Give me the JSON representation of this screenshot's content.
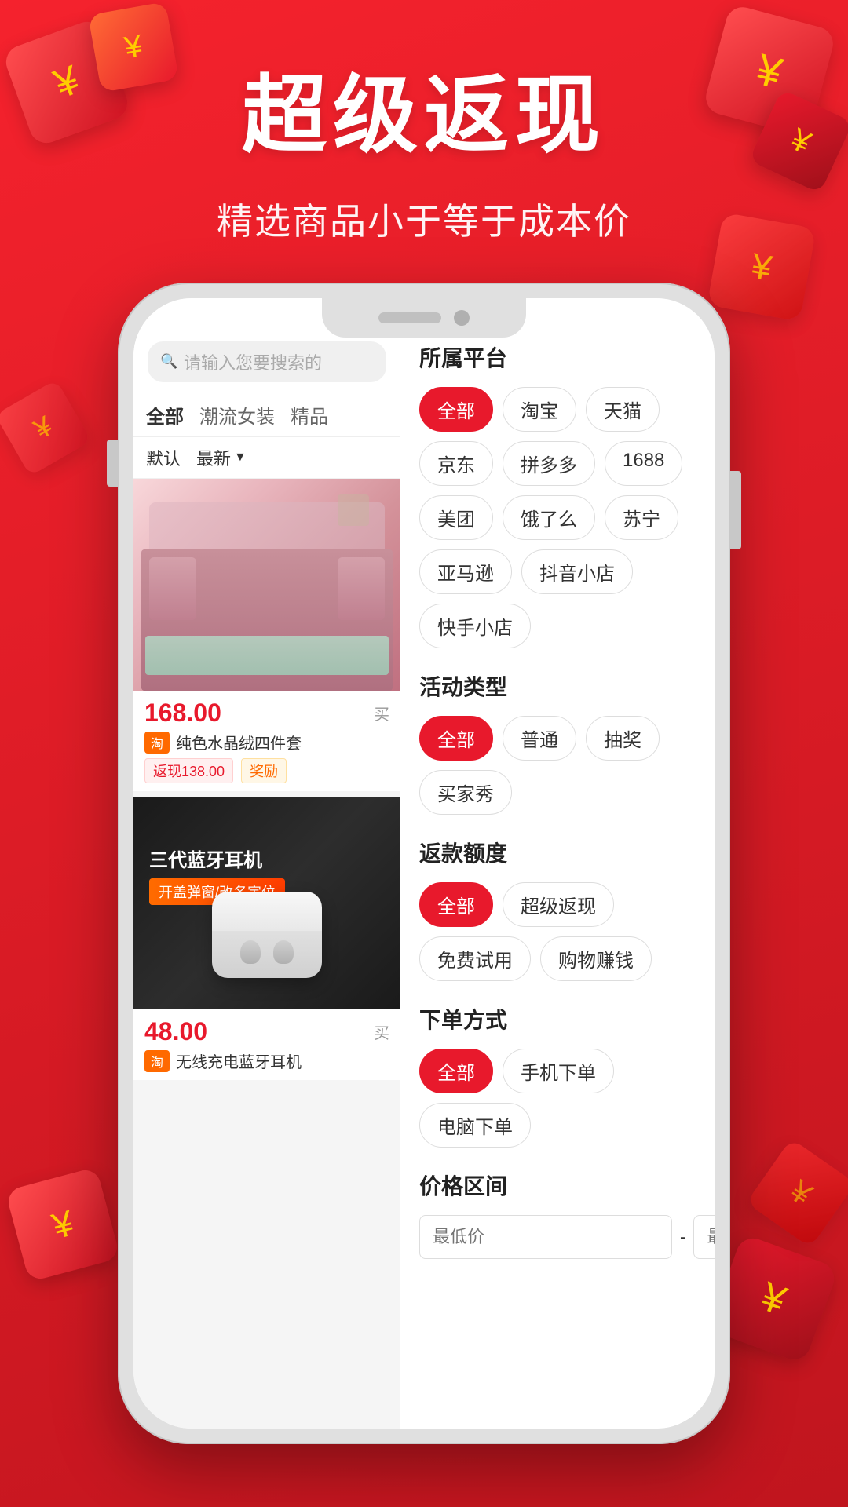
{
  "header": {
    "title": "超级返现",
    "subtitle": "精选商品小于等于成本价"
  },
  "phone": {
    "search_placeholder": "请输入您要搜索的"
  },
  "categories": {
    "tabs": [
      "全部",
      "潮流女装",
      "精品"
    ],
    "sort_options": [
      "默认",
      "最新"
    ]
  },
  "products": [
    {
      "id": 1,
      "type": "bed",
      "price": "168.00",
      "platform": "淘",
      "platform_color": "#ff6900",
      "name": "纯色水晶绒四件套",
      "cashback": "返现138.00",
      "reward": "奖励"
    },
    {
      "id": 2,
      "type": "earphone",
      "price": "48.00",
      "platform": "淘",
      "platform_color": "#ff6900",
      "name": "无线充电蓝牙耳机",
      "title_overlay": "三代蓝牙耳机",
      "badge": "开盖弹窗/改名定位"
    }
  ],
  "filters": {
    "platform": {
      "title": "所属平台",
      "options": [
        {
          "label": "全部",
          "active": true
        },
        {
          "label": "淘宝",
          "active": false
        },
        {
          "label": "天猫",
          "active": false
        },
        {
          "label": "京东",
          "active": false
        },
        {
          "label": "拼多多",
          "active": false
        },
        {
          "label": "1688",
          "active": false
        },
        {
          "label": "美团",
          "active": false
        },
        {
          "label": "饿了么",
          "active": false
        },
        {
          "label": "苏宁",
          "active": false
        },
        {
          "label": "亚马逊",
          "active": false
        },
        {
          "label": "抖音小店",
          "active": false
        },
        {
          "label": "快手小店",
          "active": false
        }
      ]
    },
    "activity": {
      "title": "活动类型",
      "options": [
        {
          "label": "全部",
          "active": true
        },
        {
          "label": "普通",
          "active": false
        },
        {
          "label": "抽奖",
          "active": false
        },
        {
          "label": "买家秀",
          "active": false
        }
      ]
    },
    "cashback": {
      "title": "返款额度",
      "options": [
        {
          "label": "全部",
          "active": true
        },
        {
          "label": "超级返现",
          "active": false
        },
        {
          "label": "免费试用",
          "active": false
        },
        {
          "label": "购物赚钱",
          "active": false
        }
      ]
    },
    "order_method": {
      "title": "下单方式",
      "options": [
        {
          "label": "全部",
          "active": true
        },
        {
          "label": "手机下单",
          "active": false
        },
        {
          "label": "电脑下单",
          "active": false
        }
      ]
    },
    "price_range": {
      "title": "价格区间",
      "min_placeholder": "最低价",
      "max_placeholder": "最高价"
    }
  }
}
